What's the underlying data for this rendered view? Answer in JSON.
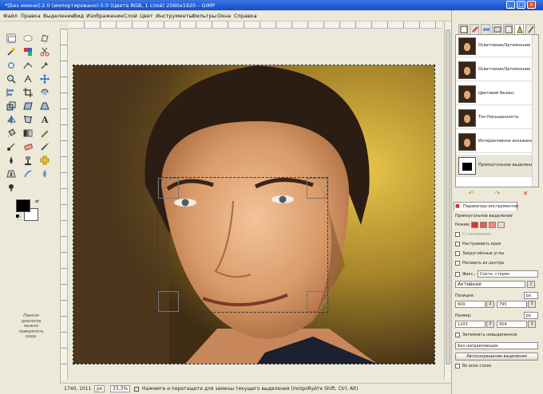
{
  "window": {
    "title": "*[Без имени]-2.0 (импортировано)-5.0 (Цвета RGB, 1 слой) 2560x1920 – GIMP"
  },
  "menu": [
    "Файл",
    "Правка",
    "Выделение",
    "Вид",
    "Изображение",
    "Слой",
    "Цвет",
    "Инструменты",
    "Фильтры",
    "Окна",
    "Справка"
  ],
  "toolbox": {
    "hint": "Панели диалогов можно прикрепить сюда.",
    "fg_color": "#000000",
    "bg_color": "#ffffff"
  },
  "history": {
    "items": [
      {
        "label": "Осветление/Затемнение",
        "thumb": "face"
      },
      {
        "label": "Осветление/Затемнение",
        "thumb": "face"
      },
      {
        "label": "Цветовой баланс",
        "thumb": "face"
      },
      {
        "label": "Тон-Насыщенность",
        "thumb": "face"
      },
      {
        "label": "Интерактивное искажение",
        "thumb": "face"
      },
      {
        "label": "Прямоугольное выделение",
        "thumb": "mask"
      }
    ]
  },
  "tool_options": {
    "tab_label": "Параметры инструментов",
    "tool_name": "Прямоугольное выделение",
    "mode_label": "Режим:",
    "antialiasing": "Сглаживание",
    "feather_edges": "Растушевать края",
    "rounded_corners": "Закруглённые углы",
    "expand_from_center": "Рисовать из центра",
    "fixed_label": "Фикс.:",
    "fixed_value": "Соотн. сторон",
    "ratio_value": "Активное",
    "position_label": "Позиция:",
    "position_unit": "px",
    "position_x": "600",
    "position_y": "795",
    "size_label": "Размер:",
    "size_unit": "px",
    "size_w": "1203",
    "size_h": "954",
    "highlight": "Затемнить невыделенное",
    "guides_value": "Без направляющих",
    "auto_shrink": "Автосокращение выделения",
    "shrink_merged": "Во всех слоях"
  },
  "status": {
    "coords": "1740, 1011",
    "unit": "px",
    "zoom": "33,3%",
    "message": "Нажмите и перетащите для замены текущего выделения (попробуйте Shift, Ctrl, Alt)"
  },
  "colors": {
    "titlebar": "#245edb",
    "panel_bg": "#ece9d8"
  }
}
